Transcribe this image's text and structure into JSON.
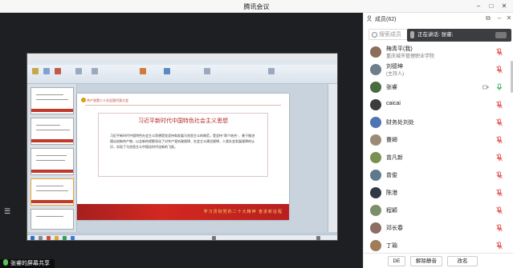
{
  "window": {
    "title": "腾讯会议"
  },
  "share": {
    "label": "张睿的屏幕共享",
    "ppt": {
      "header": "共产党第二十次全国代表大会",
      "heading": "习近平新时代中国特色社会主义思想",
      "body": "习近平新时代中国特色社会主义思想是党坚持和发展马克思主义的典范，是坚持“两个结合”、勇于推进理论创新的产物，以全新的视野深化了对共产党执政规律、社会主义建设规律、人类社会发展规律的认识，实现了马克思主义中国化时代化新的飞跃。",
      "footer": "学习贯彻党的二十大精神 奋进新征程"
    }
  },
  "panel": {
    "title": "成员(62)",
    "search_placeholder": "搜索成员",
    "speaking": "正在讲话: 张睿;",
    "participants": [
      {
        "name": "梅青平(我)",
        "sub": "重庆城市管理职业学院",
        "muted": true,
        "color": "#8a6d5a"
      },
      {
        "name": "刘德坤",
        "sub": "(主持人)",
        "muted": true,
        "color": "#6f7d8c"
      },
      {
        "name": "张睿",
        "sub": "",
        "muted": false,
        "camera": true,
        "color": "#4a6b3e"
      },
      {
        "name": "caicai",
        "sub": "",
        "muted": true,
        "color": "#3c3c3c"
      },
      {
        "name": "财务处刘处",
        "sub": "",
        "muted": true,
        "color": "#4f74b0"
      },
      {
        "name": "曹卿",
        "sub": "",
        "muted": true,
        "color": "#9b8a75"
      },
      {
        "name": "曾凡新",
        "sub": "",
        "muted": true,
        "color": "#7a8f52"
      },
      {
        "name": "曾俊",
        "sub": "",
        "muted": true,
        "color": "#5d7a8c"
      },
      {
        "name": "陈港",
        "sub": "",
        "muted": true,
        "color": "#2f3a45"
      },
      {
        "name": "程颖",
        "sub": "",
        "muted": true,
        "color": "#7b8f6a"
      },
      {
        "name": "邓长春",
        "sub": "",
        "muted": true,
        "color": "#8d6e63"
      },
      {
        "name": "丁瑜",
        "sub": "",
        "muted": true,
        "color": "#a07c5b"
      }
    ],
    "footer": {
      "de_label": "DE",
      "unmute_label": "解除静音",
      "rename_label": "改名"
    }
  },
  "colors": {
    "muted_mic": "#e55353",
    "active_mic": "#3cb371",
    "slide_red": "#b22a22"
  }
}
